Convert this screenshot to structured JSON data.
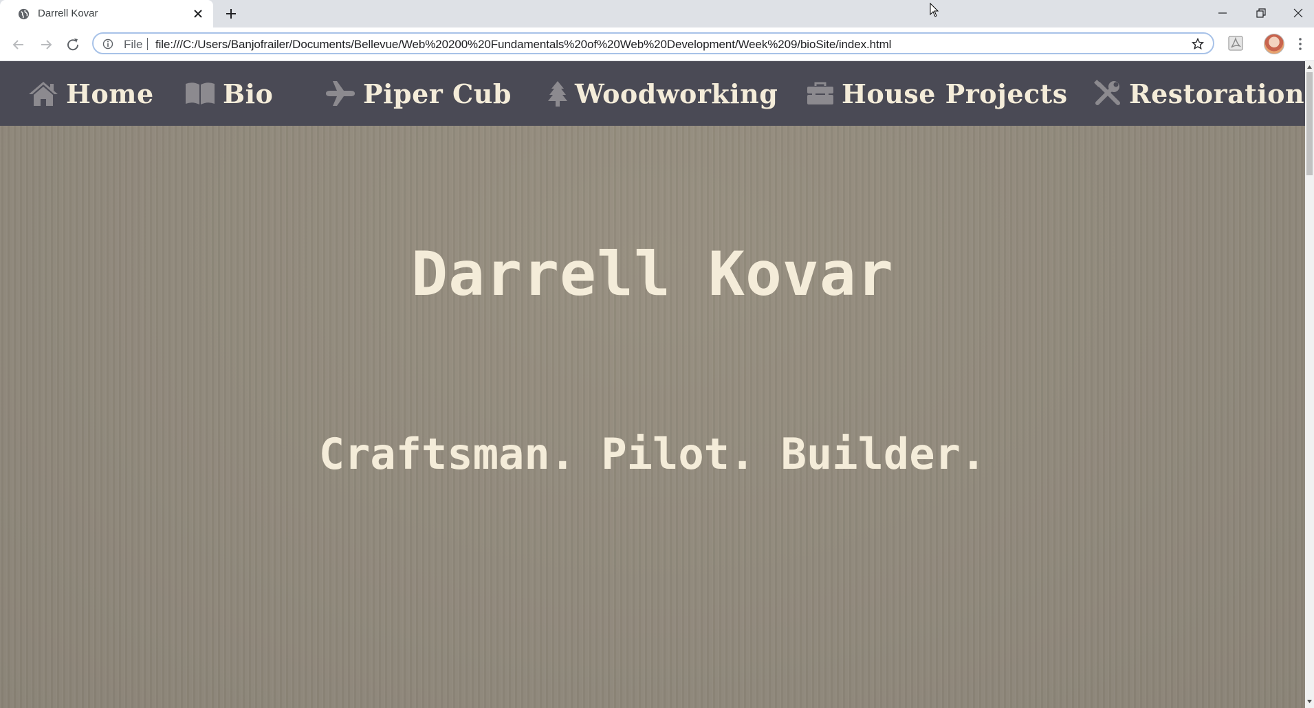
{
  "browser": {
    "tab_title": "Darrell Kovar",
    "url_scheme": "File",
    "url": "file:///C:/Users/Banjofrailer/Documents/Bellevue/Web%20200%20Fundamentals%20of%20Web%20Development/Week%209/bioSite/index.html"
  },
  "nav": {
    "items": [
      {
        "label": "Home",
        "icon": "home-icon"
      },
      {
        "label": "Bio",
        "icon": "book-icon"
      },
      {
        "label": "Piper Cub",
        "icon": "plane-icon"
      },
      {
        "label": "Woodworking",
        "icon": "tree-icon"
      },
      {
        "label": "House Projects",
        "icon": "toolbox-icon"
      },
      {
        "label": "Restoration",
        "icon": "tools-icon"
      }
    ]
  },
  "hero": {
    "title": "Darrell Kovar",
    "tagline": "Craftsman. Pilot. Builder."
  },
  "colors": {
    "nav_background": "#4a4a55",
    "text_cream": "#f4ecd9",
    "page_background": "#8f887a",
    "icon_gray": "#8c8a8f"
  }
}
